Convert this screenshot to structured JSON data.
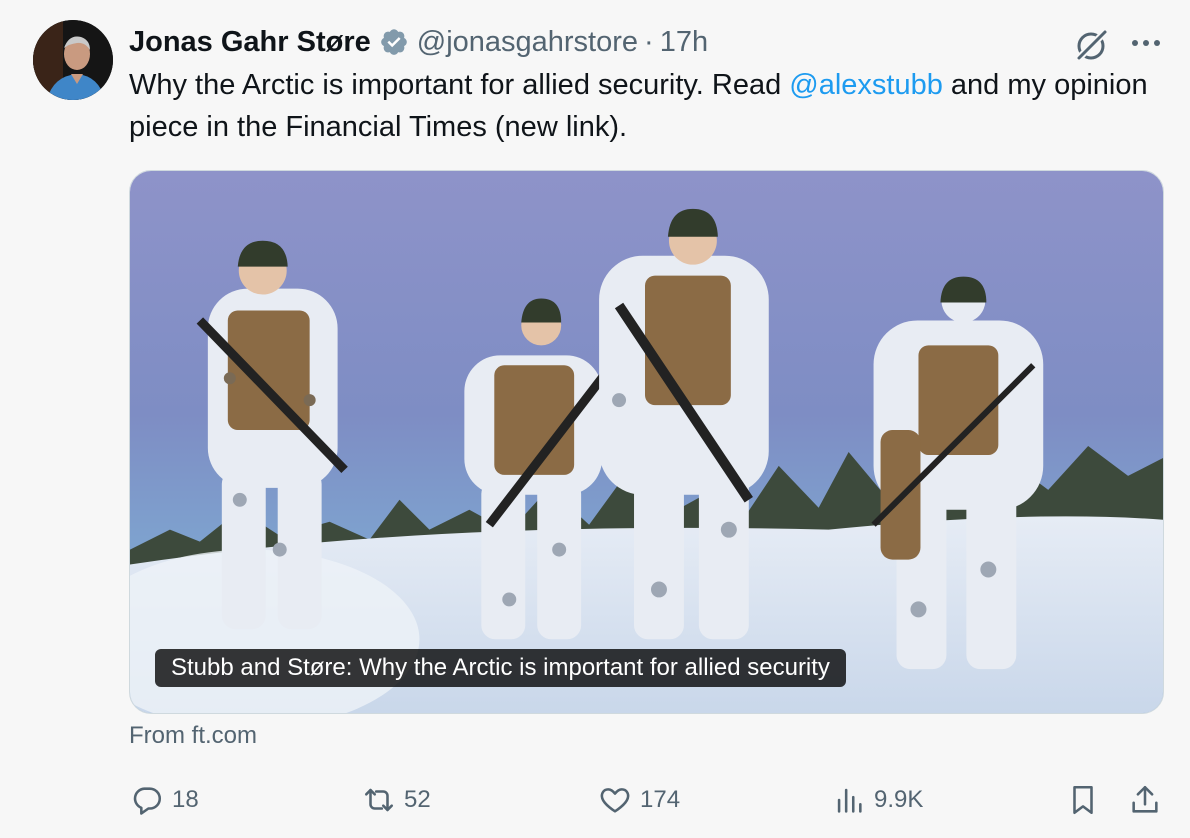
{
  "author": {
    "name": "Jonas Gahr Støre",
    "handle": "@jonasgahrstore",
    "separator": "·",
    "time": "17h"
  },
  "tweet": {
    "text_before": "Why the Arctic is important for allied security. Read ",
    "mention": "@alexstubb",
    "text_after": " and my opinion piece in the Financial Times (new link)."
  },
  "card": {
    "title": "Stubb and Støre: Why the Arctic is important for allied security",
    "source": "From ft.com"
  },
  "actions": {
    "replies": "18",
    "reposts": "52",
    "likes": "174",
    "views": "9.9K"
  },
  "colors": {
    "link": "#1d9bf0",
    "secondary_text": "#536471",
    "verified_badge": "#829aab"
  },
  "icons": [
    "verified-badge-icon",
    "grok-icon",
    "more-icon",
    "reply-icon",
    "repost-icon",
    "like-icon",
    "views-icon",
    "bookmark-icon",
    "share-icon"
  ]
}
